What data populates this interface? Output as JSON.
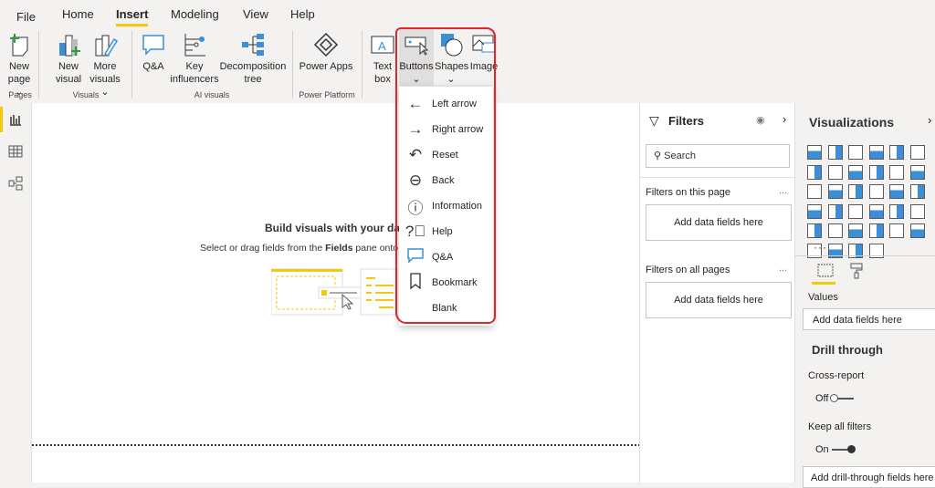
{
  "tabs": [
    "File",
    "Home",
    "Insert",
    "Modeling",
    "View",
    "Help"
  ],
  "ribbon": {
    "buttons": [
      {
        "l1": "New",
        "l2": "page ⌄"
      },
      {
        "l1": "New",
        "l2": "visual"
      },
      {
        "l1": "More",
        "l2": "visuals ⌄"
      },
      {
        "l1": "Q&A",
        "l2": ""
      },
      {
        "l1": "Key",
        "l2": "influencers"
      },
      {
        "l1": "Decomposition",
        "l2": "tree"
      },
      {
        "l1": "Power Apps",
        "l2": ""
      },
      {
        "l1": "Text",
        "l2": "box"
      },
      {
        "l1": "Buttons",
        "l2": "⌄"
      },
      {
        "l1": "Shapes",
        "l2": "⌄"
      },
      {
        "l1": "Image",
        "l2": ""
      }
    ],
    "groups": [
      "Pages",
      "Visuals",
      "AI visuals",
      "Power Platform"
    ]
  },
  "buttons_menu": [
    "Left arrow",
    "Right arrow",
    "Reset",
    "Back",
    "Information",
    "Help",
    "Q&A",
    "Bookmark",
    "Blank"
  ],
  "canvas": {
    "title": "Build visuals with your dat",
    "subtitle_pre": "Select or drag fields from the ",
    "subtitle_bold": "Fields",
    "subtitle_post": " pane onto t"
  },
  "filters": {
    "title": "Filters",
    "search_placeholder": "Search",
    "on_page": "Filters on this page",
    "on_all": "Filters on all pages",
    "add": "Add data fields here",
    "more": "..."
  },
  "viz": {
    "title": "Visualizations",
    "values": "Values",
    "add": "Add data fields here",
    "drill": "Drill through",
    "cross": "Cross-report",
    "cross_state": "Off",
    "keep": "Keep all filters",
    "keep_state": "On",
    "add_drill": "Add drill-through fields here",
    "more": "···"
  }
}
